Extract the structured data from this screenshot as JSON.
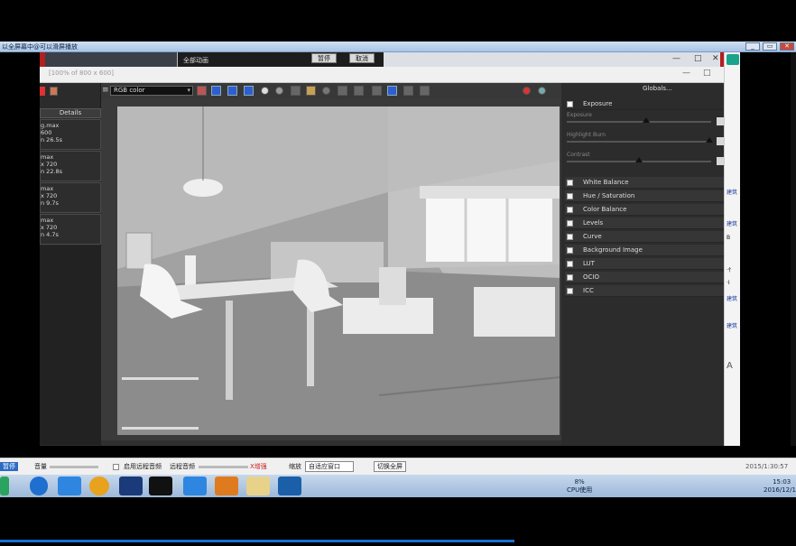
{
  "remote_bar": {
    "title": "以全屏幕中@可以滑屏播放",
    "buttons": [
      "_",
      "▭",
      "✕"
    ]
  },
  "bg_window": {
    "label": "全部动画",
    "pause_label": "暂停",
    "cancel_label": "取消",
    "controls": [
      "—",
      "□",
      "✕"
    ]
  },
  "vfb": {
    "title": "[100% of 800 x 600]",
    "controls": [
      "—",
      "□"
    ],
    "color_mode": "RGB color",
    "details_header": "Details",
    "details_items": [
      {
        "l1": "g.max",
        "l2": "600",
        "l3": "n 26.5s"
      },
      {
        "l1": "max",
        "l2": "x 720",
        "l3": "n 22.8s"
      },
      {
        "l1": "max",
        "l2": "x 720",
        "l3": "n 9.7s"
      },
      {
        "l1": "max",
        "l2": "x 720",
        "l3": "n 4.7s"
      }
    ],
    "globals_label": "Globals...",
    "exposure_label": "Exposure",
    "sliders": [
      {
        "label": "Exposure",
        "pos": 0.55
      },
      {
        "label": "Highlight Burn",
        "pos": 0.98
      },
      {
        "label": "Contrast",
        "pos": 0.5
      }
    ],
    "sections": [
      "White Balance",
      "Hue / Saturation",
      "Color Balance",
      "Levels",
      "Curve",
      "Background Image",
      "LUT",
      "OCIO",
      "ICC"
    ]
  },
  "right_column": {
    "items": [
      "建筑",
      "B",
      "建筑",
      "·忄",
      "·I",
      "建筑",
      "建筑",
      "A"
    ]
  },
  "controls": {
    "stop_label": "暂停",
    "volume_label": "音量",
    "checkbox_label": "启用远程音频",
    "quality_label": "远程音频",
    "quality_value": "X增强",
    "scale_label": "缩放",
    "scale_value": "自适应窗口",
    "fullscreen_label": "切换全屏",
    "elapsed": "2015/1:30:57"
  },
  "tray": {
    "cpu_percent": "8%",
    "cpu_label": "CPU使用",
    "time": "15:03",
    "date": "2016/12/17"
  },
  "colors": {
    "accent": "#2d5fd0",
    "teal": "#1aa38b",
    "taskbar": "#9db8da"
  }
}
